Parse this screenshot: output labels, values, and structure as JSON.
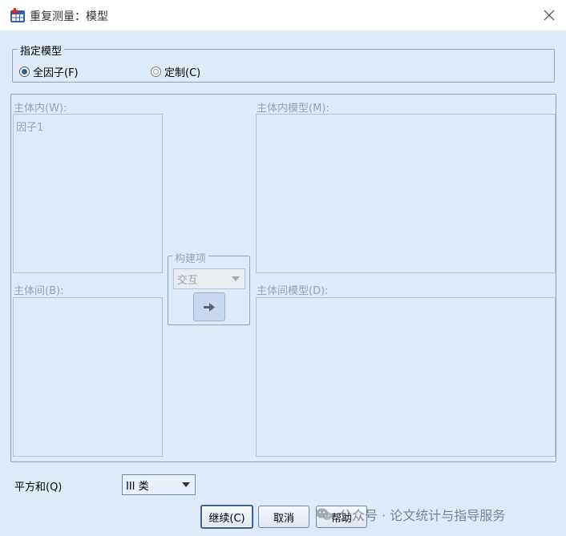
{
  "window": {
    "title": "重复测量：模型"
  },
  "specify_model": {
    "legend": "指定模型",
    "full_factorial": "全因子(F)",
    "custom": "定制(C)",
    "selected": "full_factorial"
  },
  "within_subjects": {
    "label": "主体内(W):",
    "items": [
      "因子1"
    ]
  },
  "within_model": {
    "label": "主体内模型(M):"
  },
  "between_subjects": {
    "label": "主体间(B):"
  },
  "between_model": {
    "label": "主体间模型(D):"
  },
  "build_term": {
    "legend": "构建项",
    "type": "交互"
  },
  "sum_of_squares": {
    "label": "平方和(Q)",
    "value": "III 类"
  },
  "buttons": {
    "continue": "继续(C)",
    "cancel": "取消",
    "help": "帮助"
  },
  "watermark": {
    "text": "公众号 · 论文统计与指导服务"
  },
  "colors": {
    "client_bg": "#dfeaf8",
    "border": "#8aa3c6",
    "disabled_text": "#9aa3ad",
    "accent": "#2a5fa8"
  }
}
